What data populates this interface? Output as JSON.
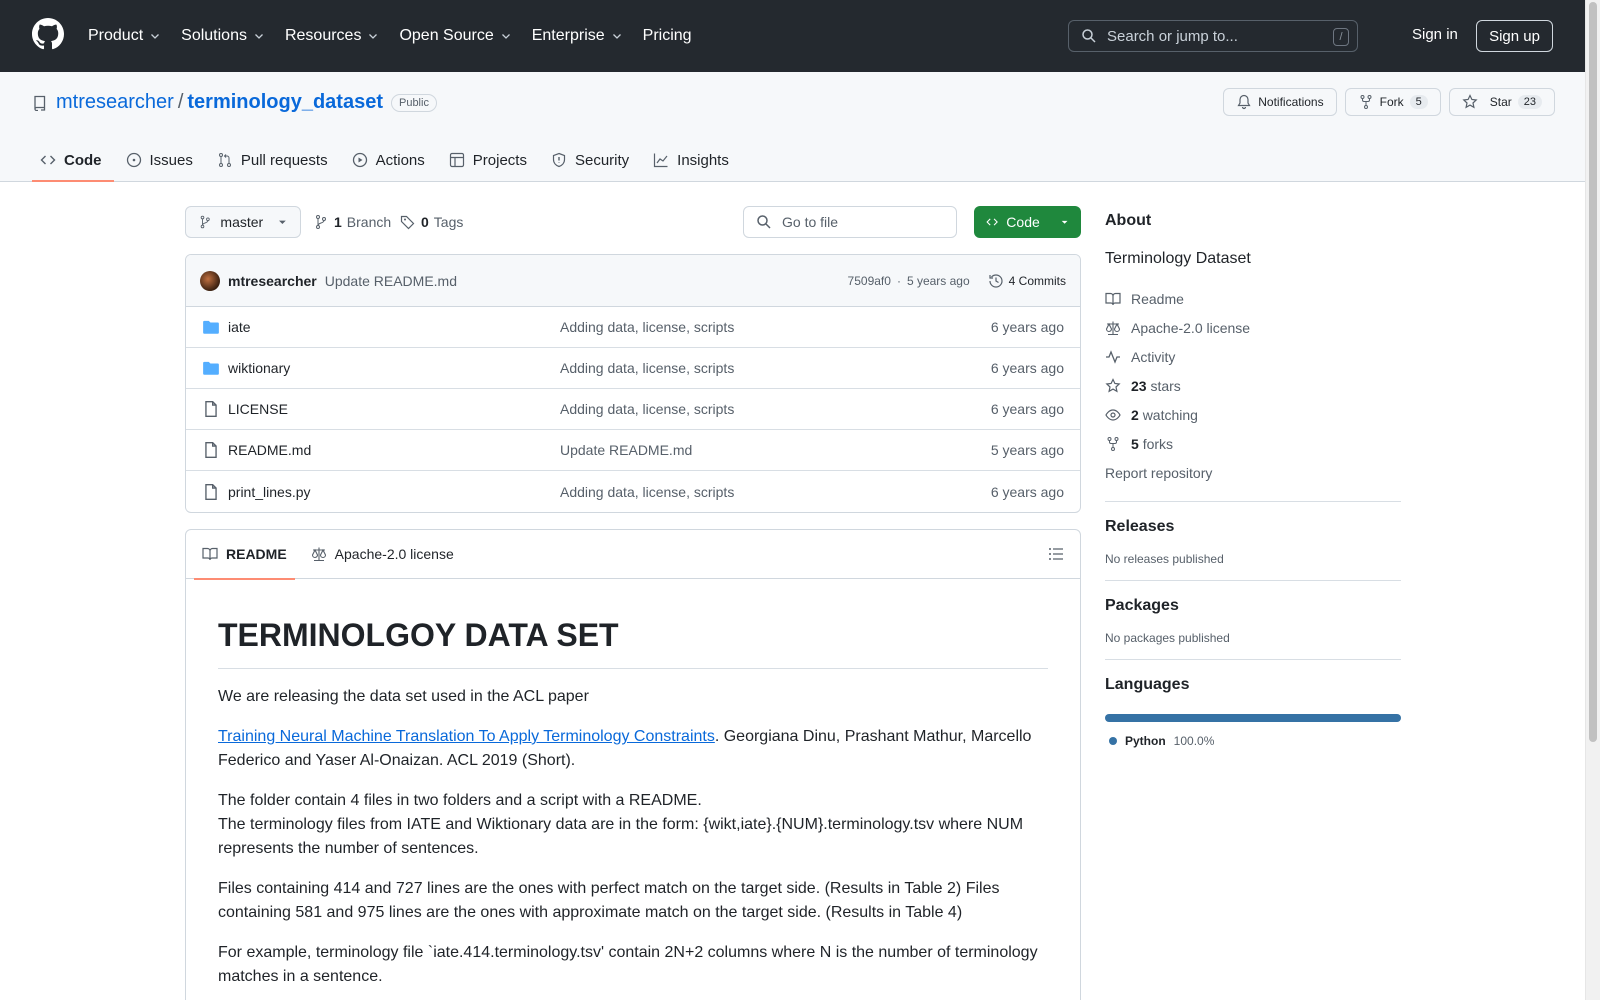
{
  "header": {
    "nav": [
      "Product",
      "Solutions",
      "Resources",
      "Open Source",
      "Enterprise",
      "Pricing"
    ],
    "search_placeholder": "Search or jump to...",
    "search_shortcut": "/",
    "sign_in": "Sign in",
    "sign_up": "Sign up"
  },
  "repo": {
    "owner": "mtresearcher",
    "separator": "/",
    "name": "terminology_dataset",
    "visibility": "Public",
    "notifications": "Notifications",
    "fork_label": "Fork",
    "fork_count": "5",
    "star_label": "Star",
    "star_count": "23",
    "tabs": [
      "Code",
      "Issues",
      "Pull requests",
      "Actions",
      "Projects",
      "Security",
      "Insights"
    ]
  },
  "toolbar": {
    "branch": "master",
    "branch_count": "1",
    "branch_label": "Branch",
    "tag_count": "0",
    "tag_label": "Tags",
    "goto_placeholder": "Go to file",
    "code_label": "Code"
  },
  "commit": {
    "author": "mtresearcher",
    "message": "Update README.md",
    "hash": "7509af0",
    "dot": "·",
    "age": "5 years ago",
    "commits": "4 Commits"
  },
  "files": [
    {
      "type": "folder",
      "name": "iate",
      "message": "Adding data, license, scripts",
      "age": "6 years ago"
    },
    {
      "type": "folder",
      "name": "wiktionary",
      "message": "Adding data, license, scripts",
      "age": "6 years ago"
    },
    {
      "type": "file",
      "name": "LICENSE",
      "message": "Adding data, license, scripts",
      "age": "6 years ago"
    },
    {
      "type": "file",
      "name": "README.md",
      "message": "Update README.md",
      "age": "5 years ago"
    },
    {
      "type": "file",
      "name": "print_lines.py",
      "message": "Adding data, license, scripts",
      "age": "6 years ago"
    }
  ],
  "readme": {
    "tab_readme": "README",
    "tab_license": "Apache-2.0 license",
    "title": "TERMINOLGOY DATA SET",
    "p1": "We are releasing the data set used in the ACL paper",
    "p2_link": "Training Neural Machine Translation To Apply Terminology Constraints",
    "p2_rest": ". Georgiana Dinu, Prashant Mathur, Marcello Federico and Yaser Al-Onaizan. ACL 2019 (Short).",
    "p3_line1": "The folder contain 4 files in two folders and a script with a README.",
    "p3_line2": "The terminology files from IATE and Wiktionary data are in the form: {wikt,iate}.{NUM}.terminology.tsv where NUM represents the number of sentences.",
    "p4": "Files containing 414 and 727 lines are the ones with perfect match on the target side. (Results in Table 2) Files containing 581 and 975 lines are the ones with approximate match on the target side. (Results in Table 4)",
    "p5": "For example, terminology file `iate.414.terminology.tsv' contain 2N+2 columns where N is the number of terminology matches in a sentence."
  },
  "sidebar": {
    "about": "About",
    "description": "Terminology Dataset",
    "readme": "Readme",
    "license": "Apache-2.0 license",
    "activity": "Activity",
    "stars_count": "23",
    "stars_label": "stars",
    "watching_count": "2",
    "watching_label": "watching",
    "forks_count": "5",
    "forks_label": "forks",
    "report": "Report repository",
    "releases": "Releases",
    "no_releases": "No releases published",
    "packages": "Packages",
    "no_packages": "No packages published",
    "languages": "Languages",
    "lang_name": "Python",
    "lang_pct": "100.0%"
  },
  "colors": {
    "header_bg": "#24292f",
    "link": "#0969da",
    "code_button": "#1f883d",
    "python": "#3572A5",
    "tab_underline": "#fd8c73"
  }
}
